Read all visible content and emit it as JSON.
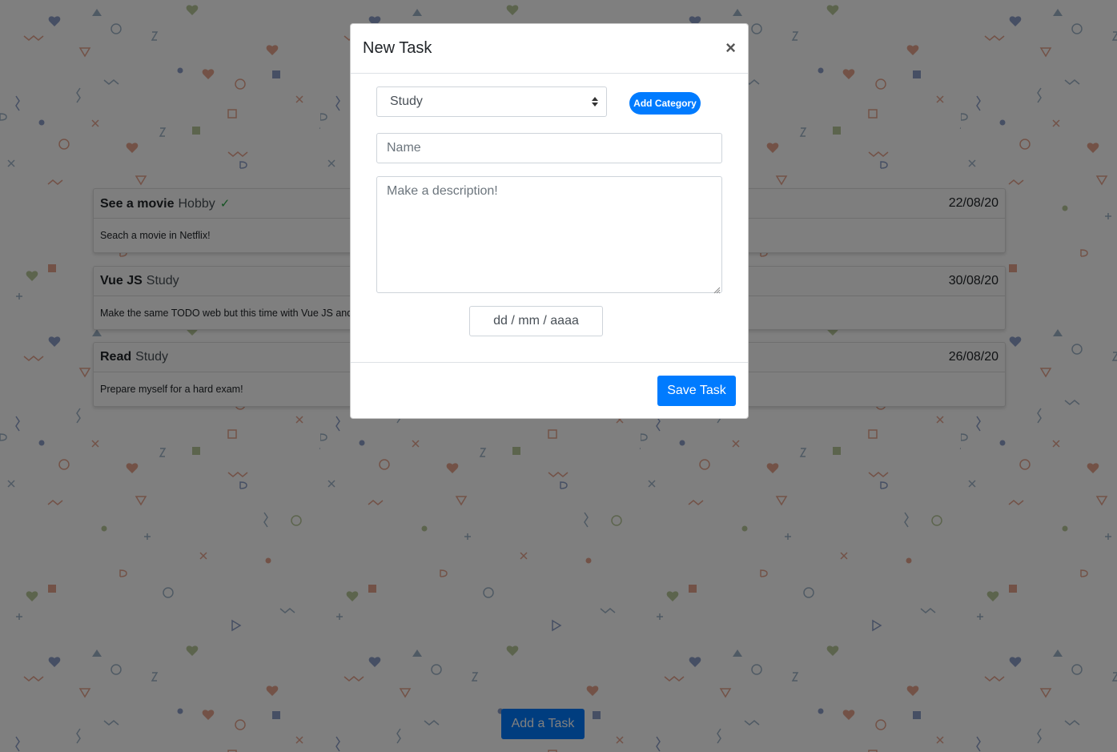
{
  "tasks": [
    {
      "title": "See a movie",
      "category": "Hobby",
      "done": true,
      "check": "✓",
      "date": "22/08/20",
      "description": "Seach a movie in Netflix!"
    },
    {
      "title": "Vue JS",
      "category": "Study",
      "done": false,
      "date": "30/08/20",
      "description": "Make the same TODO web but this time with Vue JS and"
    },
    {
      "title": "Read",
      "category": "Study",
      "done": false,
      "date": "26/08/20",
      "description": "Prepare myself for a hard exam!"
    }
  ],
  "add_task_label": "Add a Task",
  "modal": {
    "title": "New Task",
    "close_symbol": "×",
    "category_select": {
      "value": "Study"
    },
    "add_category_label": "Add Category",
    "name_placeholder": "Name",
    "description_placeholder": "Make a description!",
    "date_placeholder": "dd / mm / aaaa",
    "save_label": "Save Task"
  },
  "colors": {
    "primary": "#007bff",
    "check": "#28a745",
    "overlay": "rgba(0,0,0,0.5)"
  },
  "icons": {
    "check": "check-icon",
    "close": "close-icon",
    "select_caret": "sort-caret-icon"
  }
}
